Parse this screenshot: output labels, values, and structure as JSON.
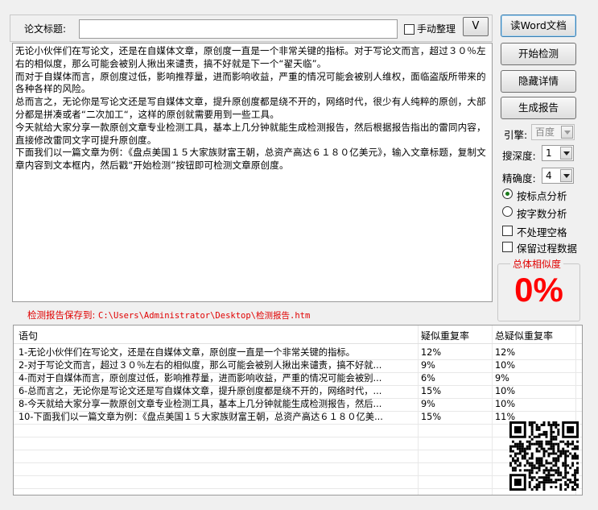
{
  "header": {
    "title_label": "论文标题:",
    "title_value": "",
    "manual_label": "手动整理",
    "manual_checked": false,
    "v_button": "V"
  },
  "buttons": {
    "read_word": "读Word文档",
    "start": "开始检测",
    "hide_details": "隐藏详情",
    "report": "生成报告"
  },
  "settings": {
    "engine_label": "引擎:",
    "engine_value": "百度",
    "depth_label": "搜深度:",
    "depth_value": "1",
    "precision_label": "精确度:",
    "precision_value": "4",
    "radio_punct": "按标点分析",
    "radio_chars": "按字数分析",
    "cb_ignore_space": "不处理空格",
    "cb_keep_data": "保留过程数据"
  },
  "similarity": {
    "label": "总体相似度",
    "value": "0%"
  },
  "main_text": [
    "无论小伙伴们在写论文，还是在自媒体文章，原创度一直是一个非常关键的指标。对于写论文而言，超过３０％左右的相似度，那么可能会被别人揪出来谴责，搞不好就是下一个“翟天临”。",
    "而对于自媒体而言，原创度过低，影响推荐量，进而影响收益，严重的情况可能会被别人维权，面临盗版所带来的各种各样的风险。",
    "总而言之，无论你是写论文还是写自媒体文章，提升原创度都是绕不开的，网络时代，很少有人纯粹的原创，大部分都是拼凑或者“二次加工“，这样的原创就需要用到一些工具。",
    "今天就给大家分享一款原创文章专业检测工具，基本上几分钟就能生成检测报告，然后根据报告指出的雷同内容，直接修改雷同文字可提升原创度。",
    "下面我们以一篇文章为例：《盘点美国１５大家族财富王朝，总资产高达６１８０亿美元》，输入文章标题，复制文章内容到文本框内，然后戳“开始检测”按钮即可检测文章原创度。"
  ],
  "save_path": {
    "label": "检测报告保存到:",
    "path": "C:\\Users\\Administrator\\Desktop\\检测报告.htm"
  },
  "table": {
    "headers": [
      "语句",
      "疑似重复率",
      "总疑似重复率"
    ],
    "rows": [
      [
        "1-无论小伙伴们在写论文，还是在自媒体文章，原创度一直是一个非常关键的指标。",
        "12%",
        "12%"
      ],
      [
        "2-对于写论文而言，超过３０％左右的相似度，那么可能会被别人揪出来谴责，搞不好就...",
        "9%",
        "10%"
      ],
      [
        "4-而对于自媒体而言，原创度过低，影响推荐量，进而影响收益，严重的情况可能会被别...",
        "6%",
        "9%"
      ],
      [
        "6-总而言之，无论你是写论文还是写自媒体文章，提升原创度都是绕不开的，网络时代，...",
        "15%",
        "10%"
      ],
      [
        "8-今天就给大家分享一款原创文章专业检测工具，基本上几分钟就能生成检测报告，然后...",
        "9%",
        "10%"
      ],
      [
        "10-下面我们以一篇文章为例：《盘点美国１５大家族财富王朝，总资产高达６１８０亿美...",
        "15%",
        "11%"
      ]
    ]
  }
}
